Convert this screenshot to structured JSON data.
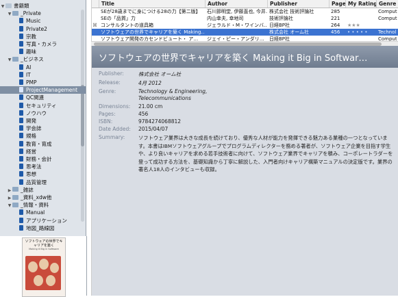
{
  "sidebar": {
    "items": [
      {
        "label": "書籍類",
        "type": "root"
      },
      {
        "label": "_Private",
        "type": "folder"
      },
      {
        "label": "Music",
        "type": "book"
      },
      {
        "label": "Private2",
        "type": "book"
      },
      {
        "label": "宗教",
        "type": "book"
      },
      {
        "label": "写真・カメラ",
        "type": "book"
      },
      {
        "label": "趣味",
        "type": "book"
      },
      {
        "label": "_ビジネス",
        "type": "folder"
      },
      {
        "label": "AI",
        "type": "book"
      },
      {
        "label": "IT",
        "type": "book"
      },
      {
        "label": "PMP",
        "type": "book"
      },
      {
        "label": "ProjectManagement",
        "type": "book"
      },
      {
        "label": "QC関連",
        "type": "book"
      },
      {
        "label": "セキュリティ",
        "type": "book"
      },
      {
        "label": "ノウハウ",
        "type": "book"
      },
      {
        "label": "開発",
        "type": "book"
      },
      {
        "label": "学会誌",
        "type": "book"
      },
      {
        "label": "規格",
        "type": "book"
      },
      {
        "label": "教育・育成",
        "type": "book"
      },
      {
        "label": "経営",
        "type": "book"
      },
      {
        "label": "財務・会計",
        "type": "book"
      },
      {
        "label": "思考法",
        "type": "book"
      },
      {
        "label": "思想",
        "type": "book"
      },
      {
        "label": "品質管理",
        "type": "book"
      },
      {
        "label": "_雑誌",
        "type": "folder-closed"
      },
      {
        "label": "_資料_xdw他",
        "type": "folder-closed"
      },
      {
        "label": "_情報・資料",
        "type": "folder"
      },
      {
        "label": "Manual",
        "type": "book"
      },
      {
        "label": "アプリケーション",
        "type": "book"
      },
      {
        "label": "地図_路線図",
        "type": "book"
      }
    ]
  },
  "cover": {
    "title": "ソフトウェアの世界でキャリアを築く",
    "subtitle": "Making It Big in Software"
  },
  "table": {
    "columns": [
      "Title",
      "Author",
      "Publisher",
      "Pages",
      "My Rating",
      "Genre"
    ],
    "rows": [
      {
        "title": "SEが28歳までに身につける28の力【第二版】",
        "author": "石川節明堂, 伊藤直也, 今井…",
        "publisher": "株式会社 技術評論社",
        "pages": "285",
        "rating": "",
        "genre": "Comput"
      },
      {
        "title": "SEの「品質」力",
        "author": "内山幸夫, 幸地司",
        "publisher": "技術評論社",
        "pages": "221",
        "rating": "",
        "genre": "Comput"
      },
      {
        "title": "コンサルタントの道具箱",
        "author": "ジェラルド・M・ワインバ…",
        "publisher": "日経BP社",
        "pages": "264",
        "rating": "★★★",
        "genre": ""
      },
      {
        "title": "ソフトウェアの世界でキャリアを築く Making…",
        "author": "",
        "publisher": "株式会社 オーム社",
        "pages": "456",
        "rating": "• • • • •",
        "genre": "Technol"
      },
      {
        "title": "ソフトウェア開発のカセンドビュート・ ア…",
        "author": "ジェイ・ピー・アンダリ…",
        "publisher": "日経BP社",
        "pages": "",
        "rating": "",
        "genre": "Comput"
      }
    ]
  },
  "detail": {
    "title": "ソフトウェアの世界でキャリアを築く Making it Big in Softwar…",
    "labels": {
      "publisher": "Publisher:",
      "release": "Release:",
      "genre": "Genre:",
      "dimensions": "Dimensions:",
      "pages": "Pages:",
      "isbn": "ISBN:",
      "date_added": "Date Added:",
      "summary": "Summary:"
    },
    "publisher": "株式会社 オーム社",
    "release": "4月 2012",
    "genre_line1": "Technology & Engineering,",
    "genre_line2": "Telecommunications",
    "dimensions": "21.00 cm",
    "pages": "456",
    "isbn": "9784274068812",
    "date_added": "2015/04/07",
    "summary": "ソフトウェア業界は大きな成長を続けており、優秀な人材が能力を発揮できる魅力ある業種の一つとなっています。本書はIBMソフトウェアグループでプログラムディレクターを務める著者が、ソフトウェア企業を目指す学生や、より良いキャリアを求める若手技術者に向けて、ソフトウェア業界でキャリアを積み、コーポレートラダーを登って成功する方法を、基礎知識から丁寧に解説した、入門者向けキャリア構築マニュアルの決定版です。業界の著名人18人のインタビューも収録。"
  },
  "colors": {
    "selection": "#3b73d1",
    "sidebar_bg": "#dfe4ea",
    "header_bg": "#7f8ca0",
    "detail_bg": "#d9dde4"
  }
}
